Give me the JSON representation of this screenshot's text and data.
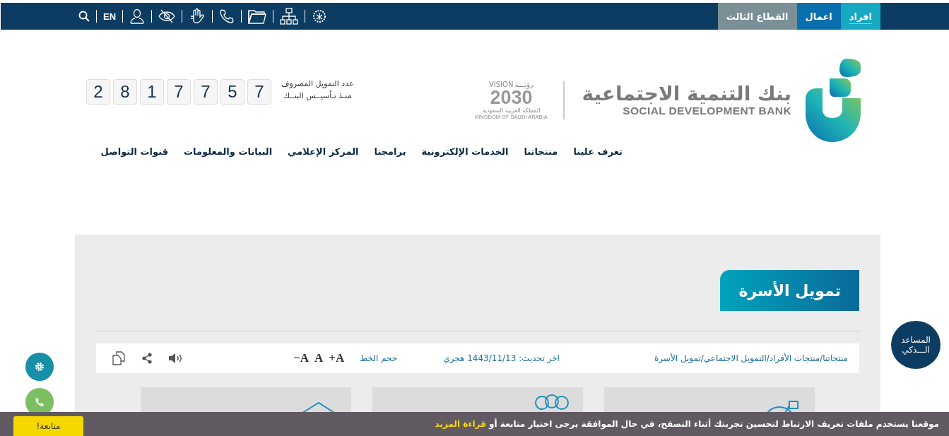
{
  "top_bar": {
    "utility_items": [
      {
        "kind": "search"
      },
      {
        "kind": "text",
        "label": "EN"
      },
      {
        "kind": "user"
      },
      {
        "kind": "eye-slash"
      },
      {
        "kind": "hand"
      },
      {
        "kind": "phone"
      },
      {
        "kind": "folder"
      },
      {
        "kind": "sitemap"
      },
      {
        "kind": "emblem"
      }
    ],
    "sector_tabs": [
      {
        "label": "افراد",
        "color": "#17a8c2",
        "selected": true
      },
      {
        "label": "اعمال",
        "color": "#0a6fae",
        "selected": false
      },
      {
        "label": "القطاع الثالث",
        "color": "#7b8f97",
        "selected": false
      }
    ]
  },
  "header": {
    "counter": {
      "label_lines": [
        "عدد التمويل المصروف",
        "منـذ تـأسيــس البنــك"
      ],
      "digits": [
        "7",
        "5",
        "7",
        "7",
        "1",
        "8",
        "2"
      ]
    },
    "vision": {
      "arabic": "رؤيـــة",
      "word": "VISION",
      "year": "2030",
      "country_ar": "المملكة العربية السعودية",
      "country_en": "KINGDOM OF SAUDI ARABIA"
    },
    "logo": {
      "arabic": "بنك التنمية الاجتماعية",
      "english": "SOCIAL DEVELOPMENT BANK"
    }
  },
  "nav": [
    "تعرف علينا",
    "منتجاتنا",
    "الخدمات الإلكترونية",
    "برامجنا",
    "المركز الإعلامي",
    "البيانات والمعلومات",
    "قنوات التواصل"
  ],
  "page": {
    "title": "تمويل الأسرة",
    "breadcrumb": [
      "منتجاتنا",
      "منتجات الأفراد",
      "التمويل الاجتماعي",
      "تمويل الأسرة"
    ],
    "breadcrumb_separator": "/",
    "updated": "اخر تحديث: 1443/11/13 هجري",
    "font_size_label": "حجم الخط",
    "font_buttons": [
      "+A",
      "A",
      "−A"
    ],
    "tools": [
      {
        "kind": "sound"
      },
      {
        "kind": "share"
      },
      {
        "kind": "copy"
      }
    ],
    "cards": [
      {
        "kind": "target"
      },
      {
        "kind": "people"
      },
      {
        "kind": "envelope"
      }
    ]
  },
  "assistant": [
    "المساعد",
    "الـــذكي"
  ],
  "side_buttons": [
    {
      "kind": "settings",
      "color": "#178fa6"
    },
    {
      "kind": "phone",
      "color": "#7cbf62"
    }
  ],
  "cookie_bar": {
    "text": "موقعنا يستخدم ملفات تعريف الارتباط لتحسين تجربتك أثناء التصفح، في حال الموافقة يرجى اختيار متابعة أو ",
    "link": "قراءة المزيد",
    "button": "متابعة!"
  }
}
